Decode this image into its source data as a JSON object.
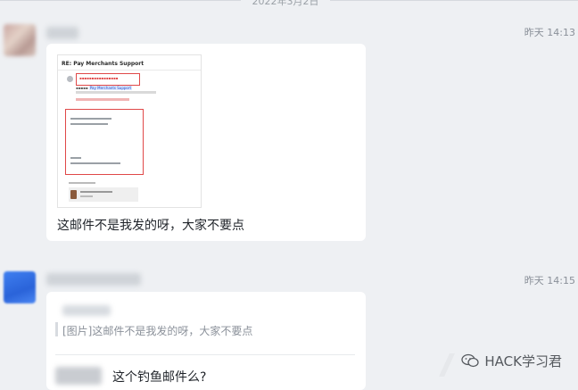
{
  "date_divider": "2022年3月2日",
  "messages": [
    {
      "timestamp": "昨天 14:13",
      "image": {
        "email_subject": "RE: Pay Merchants Support",
        "to_label": "Pay Merchants Support"
      },
      "text": "这邮件不是我发的呀，大家不要点"
    },
    {
      "timestamp": "昨天 14:15",
      "quote": "[图片]这邮件不是我发的呀，大家不要点",
      "text": "这个钓鱼邮件么?"
    }
  ],
  "watermark": "HACK学习君",
  "icons": [
    "wechat-icon",
    "person-icon",
    "attachment-file-icon"
  ]
}
